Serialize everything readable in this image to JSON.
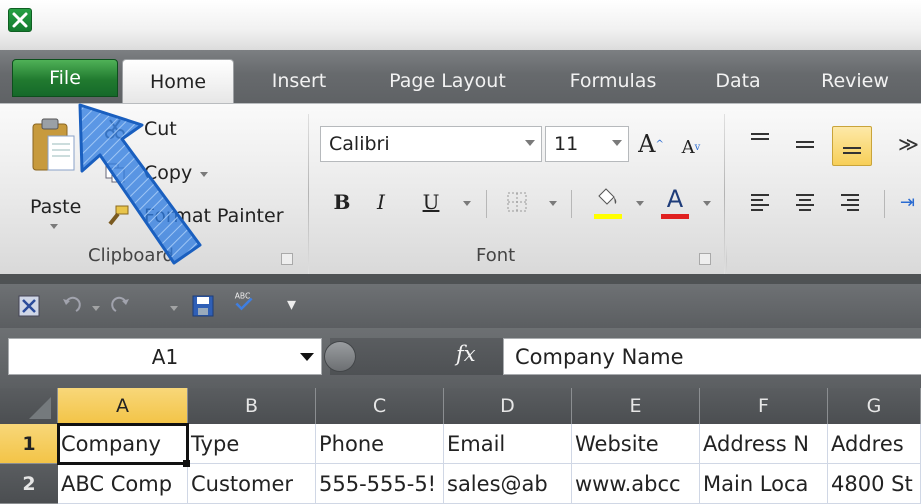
{
  "app": {
    "icon": "excel-icon"
  },
  "ribbon_tabs": [
    {
      "label": "File"
    },
    {
      "label": "Home"
    },
    {
      "label": "Insert"
    },
    {
      "label": "Page Layout"
    },
    {
      "label": "Formulas"
    },
    {
      "label": "Data"
    },
    {
      "label": "Review"
    }
  ],
  "clipboard": {
    "paste_label": "Paste",
    "cut_label": "Cut",
    "copy_label": "Copy",
    "format_painter_label": "Format Painter",
    "group_label": "Clipboard"
  },
  "font": {
    "font_name": "Calibri",
    "font_size": "11",
    "bold_glyph": "B",
    "italic_glyph": "I",
    "underline_glyph": "U",
    "grow_glyph": "A",
    "shrink_glyph": "A",
    "font_color_glyph": "A",
    "group_label": "Font",
    "highlight_color": "#ffff00",
    "font_color": "#e02020"
  },
  "quick_access": {
    "items": [
      "excel-small-icon",
      "undo-icon",
      "redo-icon",
      "save-icon",
      "spelling-icon",
      "customize-icon"
    ],
    "customize_glyph": "▾"
  },
  "formula_bar": {
    "name_box": "A1",
    "fx_label": "fx",
    "content": "Company Name"
  },
  "sheet": {
    "columns": [
      "A",
      "B",
      "C",
      "D",
      "E",
      "F",
      "G"
    ],
    "rows": [
      {
        "num": "1",
        "cells": [
          "Company",
          "Type",
          "Phone",
          "Email",
          "Website",
          "Address N",
          "Addres"
        ]
      },
      {
        "num": "2",
        "cells": [
          "ABC Comp",
          "Customer",
          "555-555-5!",
          "sales@ab",
          "www.abcc",
          "Main Loca",
          "4800 St"
        ]
      }
    ],
    "selected_cell": "A1",
    "accent": "#f3c447"
  },
  "annotation": {
    "icon": "pointer-arrow-icon",
    "color": "#1e6fd0"
  }
}
